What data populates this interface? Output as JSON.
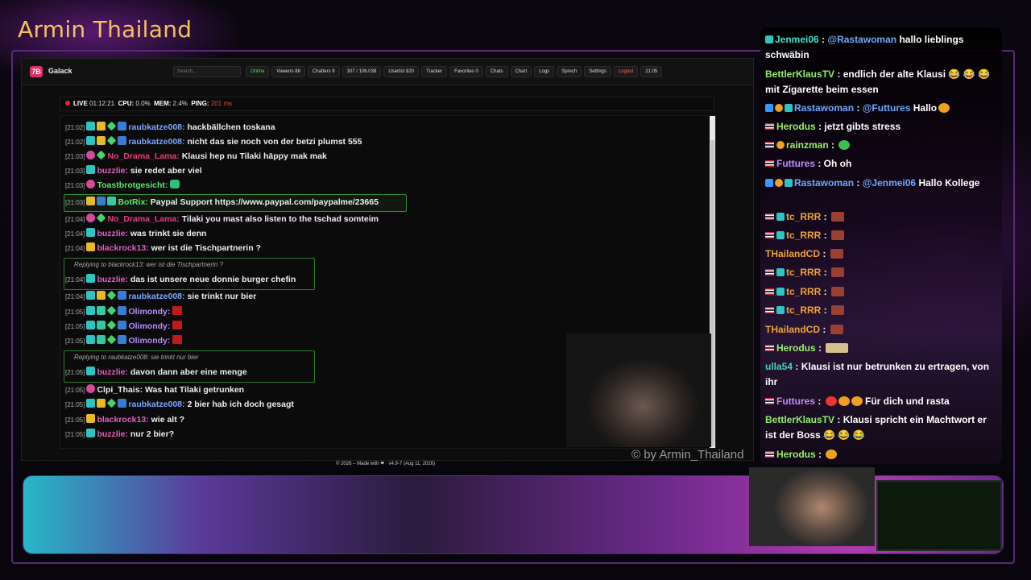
{
  "stream": {
    "title": "Armin Thailand",
    "watermark": "© by Armin_Thailand"
  },
  "dashboard": {
    "app_name": "Galack",
    "logo_text": "7B",
    "search_placeholder": "Search...",
    "toolbar": [
      {
        "name": "online",
        "label": "Online"
      },
      {
        "name": "viewers",
        "label": "Viewers 88"
      },
      {
        "name": "chatters",
        "label": "Chatters 9"
      },
      {
        "name": "messages",
        "label": "307 / 106.038"
      },
      {
        "name": "userlist",
        "label": "Userlist 820"
      },
      {
        "name": "tracker",
        "label": "Tracker"
      },
      {
        "name": "favorites",
        "label": "Favorites 0"
      },
      {
        "name": "chats",
        "label": "Chats"
      },
      {
        "name": "chart",
        "label": "Chart"
      },
      {
        "name": "logs",
        "label": "Logs"
      },
      {
        "name": "sprech",
        "label": "Sprech"
      },
      {
        "name": "settings",
        "label": "Settings"
      },
      {
        "name": "logout",
        "label": "Logout"
      },
      {
        "name": "clock",
        "label": "21:05"
      }
    ],
    "status": {
      "live_label": "LIVE",
      "uptime": "01:12:21",
      "cpu_label": "CPU:",
      "cpu": "0.0%",
      "mem_label": "MEM:",
      "mem": "2.4%",
      "ping_label": "PING:",
      "ping": "201 ms"
    },
    "footer": "© 2026 – Made with ❤ · v4.9-7 (Aug 11, 2026)",
    "messages": [
      {
        "time": "[21:02]",
        "user": "raubkatze008:",
        "text": "hackbällchen toskana"
      },
      {
        "time": "[21:02]",
        "user": "raubkatze008:",
        "text": "nicht das sie noch von der betzi plumst 555"
      },
      {
        "time": "[21:03]",
        "user": "No_Drama_Lama:",
        "text": "Klausi hep nu Tilaki häppy mak mak"
      },
      {
        "time": "[21:03]",
        "user": "buzzlie:",
        "text": "sie redet aber viel"
      },
      {
        "time": "[21:03]",
        "user": "Toastbrotgesicht:",
        "text": ""
      },
      {
        "time": "[21:03]",
        "user": "BotRix:",
        "text": "Paypal Support https://www.paypal.com/paypalme/23665"
      },
      {
        "time": "[21:04]",
        "user": "No_Drama_Lama:",
        "text": "Tilaki you mast also listen to the tschad somteim"
      },
      {
        "time": "[21:04]",
        "user": "buzzlie:",
        "text": "was trinkt sie denn"
      },
      {
        "time": "[21:04]",
        "user": "blackrock13:",
        "text": "wer ist die Tischpartnerin ?"
      },
      {
        "time": "[21:04]",
        "user": "buzzlie:",
        "text": "das ist unsere neue donnie burger chefin",
        "reply": "Replying to blackrock13: wer ist die Tischpartnerin ?"
      },
      {
        "time": "[21:04]",
        "user": "raubkatze008:",
        "text": "sie trinkt nur bier"
      },
      {
        "time": "[21:05]",
        "user": "Olimondy:",
        "text": ""
      },
      {
        "time": "[21:05]",
        "user": "Olimondy:",
        "text": ""
      },
      {
        "time": "[21:05]",
        "user": "Olimondy:",
        "text": ""
      },
      {
        "time": "[21:05]",
        "user": "buzzlie:",
        "text": "davon dann aber eine menge",
        "reply": "Replying to raubkatze008: sie trinkt nur bier"
      },
      {
        "time": "[21:05]",
        "user": "Clpi_Thais:",
        "text": "Was hat Tilaki getrunken"
      },
      {
        "time": "[21:05]",
        "user": "raubkatze008:",
        "text": "2 bier hab ich doch gesagt"
      },
      {
        "time": "[21:05]",
        "user": "blackrock13:",
        "text": "wie alt ?"
      },
      {
        "time": "[21:05]",
        "user": "buzzlie:",
        "text": "nur 2 bier?"
      }
    ]
  },
  "side_chat": [
    {
      "user": "Jenmei06",
      "sep": " : ",
      "mention": "@Rastawoman",
      "text": " hallo lieblings schwäbin"
    },
    {
      "user": "BettlerKlausTV",
      "sep": " : ",
      "mention": "",
      "text": "endlich der alte Klausi 😂 😂 😂 mit Zigarette beim essen"
    },
    {
      "user": "Rastawoman",
      "sep": " : ",
      "mention": "@Futtures",
      "text": " Hallo"
    },
    {
      "user": "Herodus",
      "sep": " : ",
      "mention": "",
      "text": "jetzt gibts stress"
    },
    {
      "user": "rainzman",
      "sep": " : ",
      "mention": "",
      "text": ""
    },
    {
      "user": "Futtures",
      "sep": " : ",
      "mention": "",
      "text": "Oh oh"
    },
    {
      "user": "Rastawoman",
      "sep": " : ",
      "mention": "@Jenmei06",
      "text": " Hallo Kollege"
    },
    {
      "user": "tc_RRR",
      "sep": " : ",
      "mention": "",
      "text": ""
    },
    {
      "user": "tc_RRR",
      "sep": " : ",
      "mention": "",
      "text": ""
    },
    {
      "user": "THailandCD",
      "sep": " : ",
      "mention": "",
      "text": ""
    },
    {
      "user": "tc_RRR",
      "sep": " : ",
      "mention": "",
      "text": ""
    },
    {
      "user": "tc_RRR",
      "sep": " : ",
      "mention": "",
      "text": ""
    },
    {
      "user": "tc_RRR",
      "sep": " : ",
      "mention": "",
      "text": ""
    },
    {
      "user": "THailandCD",
      "sep": " : ",
      "mention": "",
      "text": ""
    },
    {
      "user": "Herodus",
      "sep": " : ",
      "mention": "",
      "text": ""
    },
    {
      "user": "ulla54",
      "sep": " : ",
      "mention": "",
      "text": "Klausi ist nur betrunken zu ertragen, von ihr"
    },
    {
      "user": "Futtures",
      "sep": " : ",
      "mention": "",
      "text": "Für dich und rasta"
    },
    {
      "user": "BettlerKlausTV",
      "sep": " : ",
      "mention": "",
      "text": "Klausi spricht ein Machtwort er ist der Boss 😂 😂 😂"
    },
    {
      "user": "Herodus",
      "sep": " : ",
      "mention": "",
      "text": ""
    }
  ]
}
